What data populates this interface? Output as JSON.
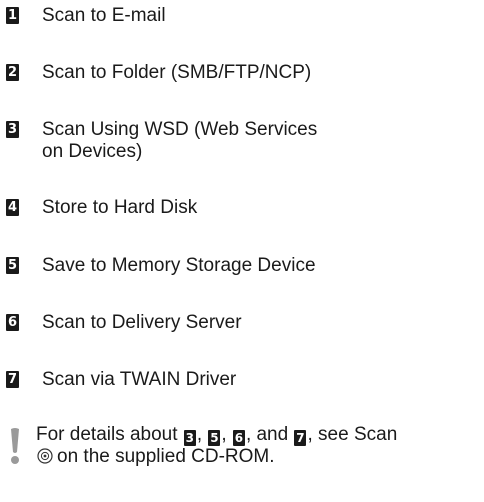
{
  "items": [
    {
      "num": "1",
      "label": "Scan to E-mail"
    },
    {
      "num": "2",
      "label": "Scan to Folder (SMB/FTP/NCP)"
    },
    {
      "num": "3",
      "label": "Scan Using WSD (Web Services on Devices)"
    },
    {
      "num": "4",
      "label": "Store to Hard Disk"
    },
    {
      "num": "5",
      "label": "Save to Memory Storage Device"
    },
    {
      "num": "6",
      "label": "Scan to Delivery Server"
    },
    {
      "num": "7",
      "label": "Scan via TWAIN Driver"
    }
  ],
  "note": {
    "prefix": "For details about",
    "ref1": "3",
    "sep1": ",",
    "ref2": "5",
    "sep2": ",",
    "ref3": "6",
    "sep3": ", and",
    "ref4": "7",
    "middle": ", see Scan",
    "suffix": "on the supplied CD-ROM.",
    "icon": "exclamation-icon",
    "cd_icon": "cd-rom-icon"
  }
}
